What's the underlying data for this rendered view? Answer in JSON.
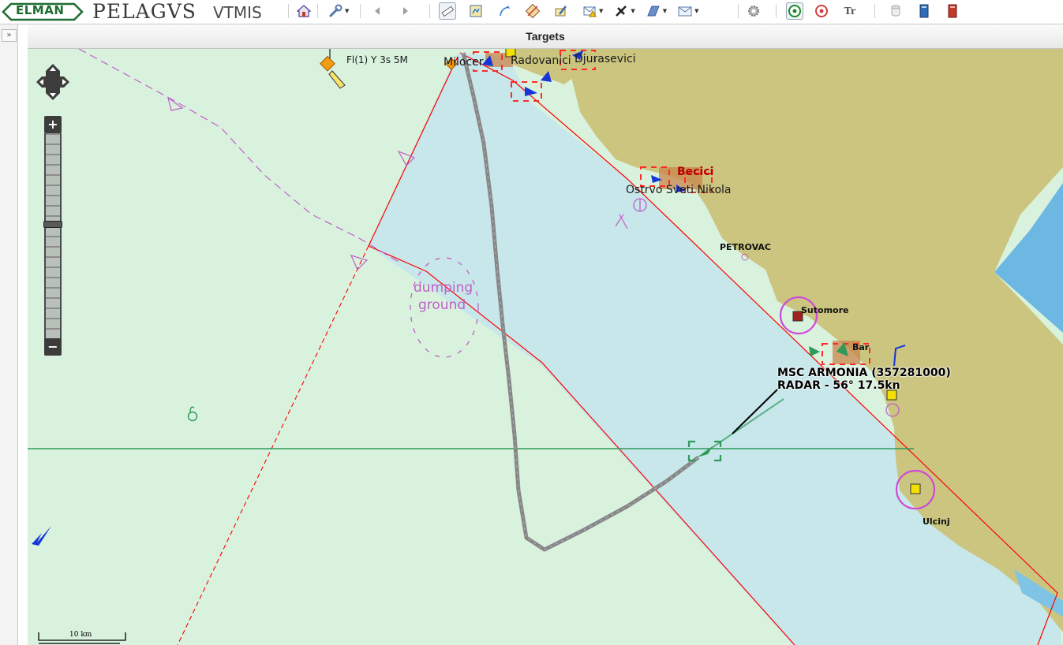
{
  "toolbar": {
    "brand_elman": "ELMAN",
    "brand_pelagvs": "PELAGVS",
    "brand_vtmis": "VTMIS",
    "text_tool_label": "Tr"
  },
  "panel": {
    "title": "Targets"
  },
  "sidebar": {
    "expand_label": "»"
  },
  "map": {
    "zoom_in": "+",
    "zoom_out": "−",
    "scale_label": "10 km",
    "light_label": "Fl(1) Y 3s 5M",
    "area_label_line1": "dumping",
    "area_label_line2": "ground",
    "places": {
      "milocer": "Milocer",
      "radovanici": "Radovanici",
      "djurasevici": "Djurasevici",
      "becici": "Becici",
      "ostrvo": "Ostrvo Sveti Nikola",
      "petrovac": "PETROVAC",
      "sutomore": "Sutomore",
      "bar": "Bar",
      "ulcinj": "Ulcinj"
    },
    "target": {
      "name": "MSC ARMONIA (357281000)",
      "info": "RADAR - 56° 17.5kn"
    }
  },
  "colors": {
    "sea_shallow": "#d9f2de",
    "sea_channel": "#c7e7ea",
    "land": "#cbc57f",
    "deep_water": "#6cb8e2",
    "boundary": "#ff0000",
    "track": "#878787",
    "target_accent": "#2f9a5a",
    "magenta": "#c060c8"
  }
}
